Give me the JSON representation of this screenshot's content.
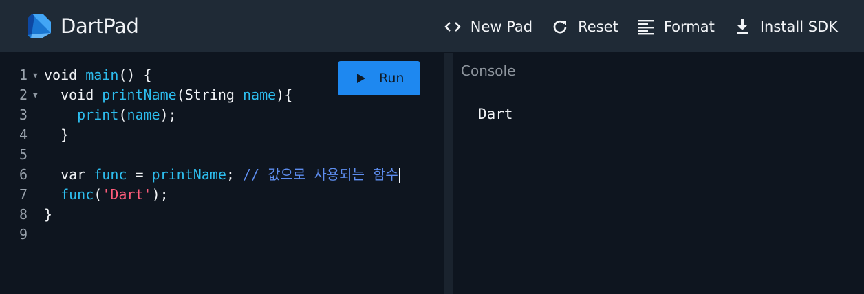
{
  "app": {
    "title": "DartPad"
  },
  "toolbar": {
    "new_pad": "New Pad",
    "reset": "Reset",
    "format": "Format",
    "install_sdk": "Install SDK"
  },
  "editor": {
    "run_label": "Run",
    "lines": [
      {
        "num": "1",
        "parts": [
          {
            "t": "void ",
            "c": "kw"
          },
          {
            "t": "main",
            "c": "fn"
          },
          {
            "t": "() {",
            "c": "kw"
          }
        ]
      },
      {
        "num": "2",
        "parts": [
          {
            "t": "  void ",
            "c": "kw"
          },
          {
            "t": "printName",
            "c": "fn"
          },
          {
            "t": "(String ",
            "c": "kw"
          },
          {
            "t": "name",
            "c": "fn"
          },
          {
            "t": "){",
            "c": "kw"
          }
        ]
      },
      {
        "num": "3",
        "parts": [
          {
            "t": "    ",
            "c": "kw"
          },
          {
            "t": "print",
            "c": "fn"
          },
          {
            "t": "(",
            "c": "kw"
          },
          {
            "t": "name",
            "c": "fn"
          },
          {
            "t": ");",
            "c": "kw"
          }
        ]
      },
      {
        "num": "4",
        "parts": [
          {
            "t": "  }",
            "c": "kw"
          }
        ]
      },
      {
        "num": "5",
        "parts": []
      },
      {
        "num": "6",
        "parts": [
          {
            "t": "  var ",
            "c": "kw"
          },
          {
            "t": "func",
            "c": "fn"
          },
          {
            "t": " = ",
            "c": "kw"
          },
          {
            "t": "printName",
            "c": "fn"
          },
          {
            "t": "; ",
            "c": "kw"
          },
          {
            "t": "// ",
            "c": "cm"
          },
          {
            "t": "값으로 사용되는 함수",
            "c": "cm ko"
          }
        ]
      },
      {
        "num": "7",
        "parts": [
          {
            "t": "  ",
            "c": "kw"
          },
          {
            "t": "func",
            "c": "fn"
          },
          {
            "t": "(",
            "c": "kw"
          },
          {
            "t": "'Dart'",
            "c": "str"
          },
          {
            "t": ");",
            "c": "kw"
          }
        ]
      },
      {
        "num": "8",
        "parts": [
          {
            "t": "}",
            "c": "kw"
          }
        ]
      },
      {
        "num": "9",
        "parts": []
      }
    ]
  },
  "console": {
    "title": "Console",
    "output": "Dart"
  }
}
